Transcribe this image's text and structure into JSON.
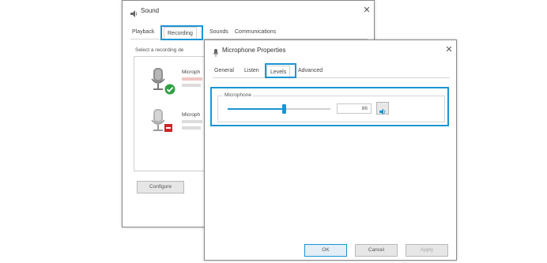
{
  "colors": {
    "highlight": "#1b95d3",
    "success": "#2ea043",
    "error": "#c62828"
  },
  "sound": {
    "title": "Sound",
    "tabs": [
      "Playback",
      "Recording",
      "Sounds",
      "Communications"
    ],
    "active_tab": "Recording",
    "instruction": "Select a recording de",
    "devices": [
      {
        "name": "Microph",
        "line2": "",
        "line3": "",
        "status_icon": "check-icon"
      },
      {
        "name": "Microph",
        "line2": "",
        "line3": "",
        "status_icon": "disabled-icon"
      }
    ],
    "configure_label": "Configure"
  },
  "mic": {
    "title": "Microphone Properties",
    "tabs": [
      "General",
      "Listen",
      "Levels",
      "Advanced"
    ],
    "active_tab": "Levels",
    "group_label": "Microphone",
    "level_value": "86",
    "level_fraction": 0.55,
    "buttons": {
      "ok": "OK",
      "cancel": "Cancel",
      "apply": "Apply"
    }
  }
}
